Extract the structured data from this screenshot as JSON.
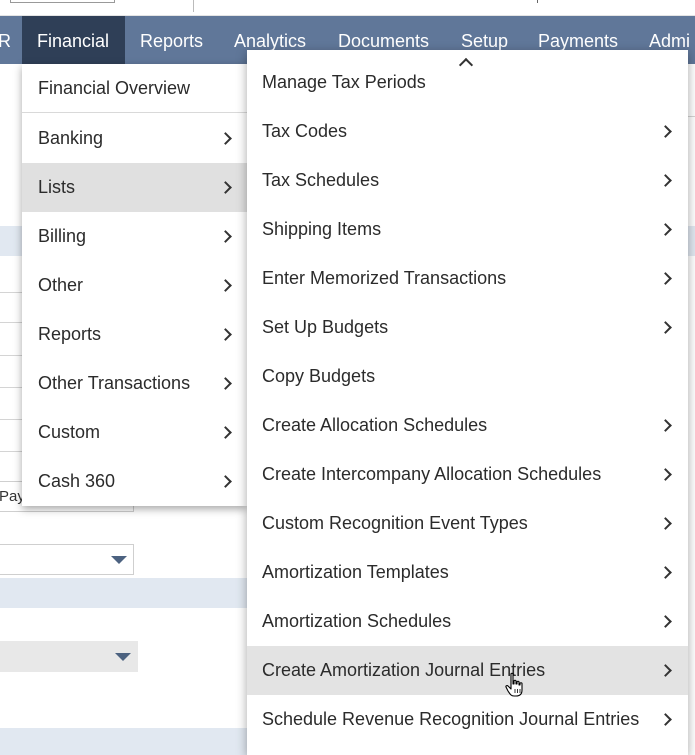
{
  "nav": {
    "items": [
      {
        "label": "R"
      },
      {
        "label": "Financial"
      },
      {
        "label": "Reports"
      },
      {
        "label": "Analytics"
      },
      {
        "label": "Documents"
      },
      {
        "label": "Setup"
      },
      {
        "label": "Payments"
      },
      {
        "label": "Admi"
      }
    ],
    "active": "Financial"
  },
  "background": {
    "partial_text": "Pay"
  },
  "financial_menu": {
    "overview": "Financial Overview",
    "items": [
      {
        "label": "Banking",
        "has_submenu": true
      },
      {
        "label": "Lists",
        "has_submenu": true,
        "highlighted": true
      },
      {
        "label": "Billing",
        "has_submenu": true
      },
      {
        "label": "Other",
        "has_submenu": true
      },
      {
        "label": "Reports",
        "has_submenu": true
      },
      {
        "label": "Other Transactions",
        "has_submenu": true
      },
      {
        "label": "Custom",
        "has_submenu": true
      },
      {
        "label": "Cash 360",
        "has_submenu": true
      }
    ]
  },
  "lists_submenu": {
    "items": [
      {
        "label": "Manage Tax Periods",
        "has_submenu": false
      },
      {
        "label": "Tax Codes",
        "has_submenu": true
      },
      {
        "label": "Tax Schedules",
        "has_submenu": true
      },
      {
        "label": "Shipping Items",
        "has_submenu": true
      },
      {
        "label": "Enter Memorized Transactions",
        "has_submenu": true
      },
      {
        "label": "Set Up Budgets",
        "has_submenu": true
      },
      {
        "label": "Copy Budgets",
        "has_submenu": false
      },
      {
        "label": "Create Allocation Schedules",
        "has_submenu": true
      },
      {
        "label": "Create Intercompany Allocation Schedules",
        "has_submenu": true
      },
      {
        "label": "Custom Recognition Event Types",
        "has_submenu": true
      },
      {
        "label": "Amortization Templates",
        "has_submenu": true
      },
      {
        "label": "Amortization Schedules",
        "has_submenu": true
      },
      {
        "label": "Create Amortization Journal Entries",
        "has_submenu": true,
        "highlighted": true
      },
      {
        "label": "Schedule Revenue Recognition Journal Entries",
        "has_submenu": true
      }
    ]
  },
  "colors": {
    "navbar": "#607799",
    "nav_active": "#2f3f57",
    "hover": "#e0e0e0",
    "accent_caret": "#4c6280"
  },
  "icons": {
    "submenu": "chevron-right-icon",
    "scroll_up": "chevron-up-icon",
    "cursor": "hand-pointer-icon"
  }
}
